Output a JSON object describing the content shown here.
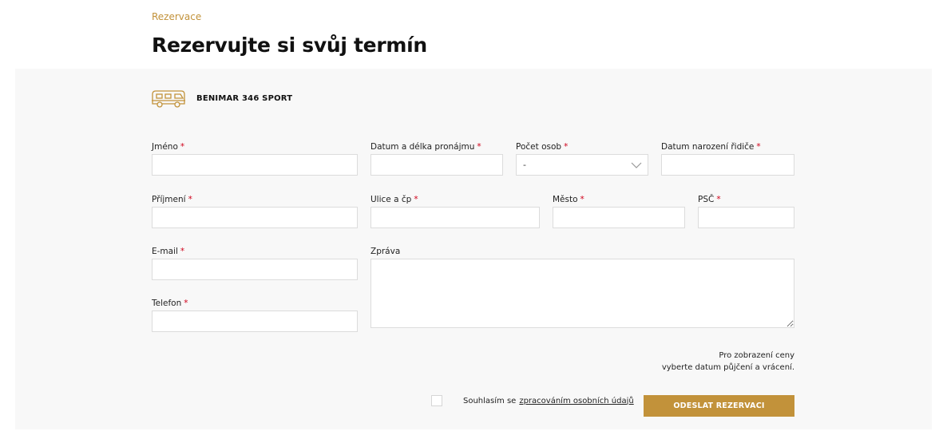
{
  "breadcrumb": "Rezervace",
  "title": "Rezervujte si svůj termín",
  "vehicle": {
    "icon": "camper-van-icon",
    "name": "BENIMAR 346 SPORT"
  },
  "form": {
    "required_mark": "*",
    "first_name": {
      "label": "Jméno",
      "value": ""
    },
    "rental_date": {
      "label": "Datum a délka pronájmu",
      "value": ""
    },
    "persons": {
      "label": "Počet osob",
      "value": "-"
    },
    "driver_birth_date": {
      "label": "Datum narození řidiče",
      "value": ""
    },
    "last_name": {
      "label": "Příjmení",
      "value": ""
    },
    "street": {
      "label": "Ulice a čp",
      "value": ""
    },
    "city": {
      "label": "Město",
      "value": ""
    },
    "zip": {
      "label": "PSČ",
      "value": ""
    },
    "email": {
      "label": "E-mail",
      "value": ""
    },
    "message": {
      "label": "Zpráva",
      "value": ""
    },
    "phone": {
      "label": "Telefon",
      "value": ""
    }
  },
  "price_note": {
    "line1": "Pro zobrazení ceny",
    "line2": "vyberte datum půjčení a vrácení."
  },
  "consent": {
    "text": "Souhlasím se",
    "link": "zpracováním osobních údajů",
    "checked": false
  },
  "submit_label": "ODESLAT REZERVACI",
  "colors": {
    "accent": "#c2923a",
    "required": "#d0021b",
    "panel_bg": "#f8f8f8"
  }
}
